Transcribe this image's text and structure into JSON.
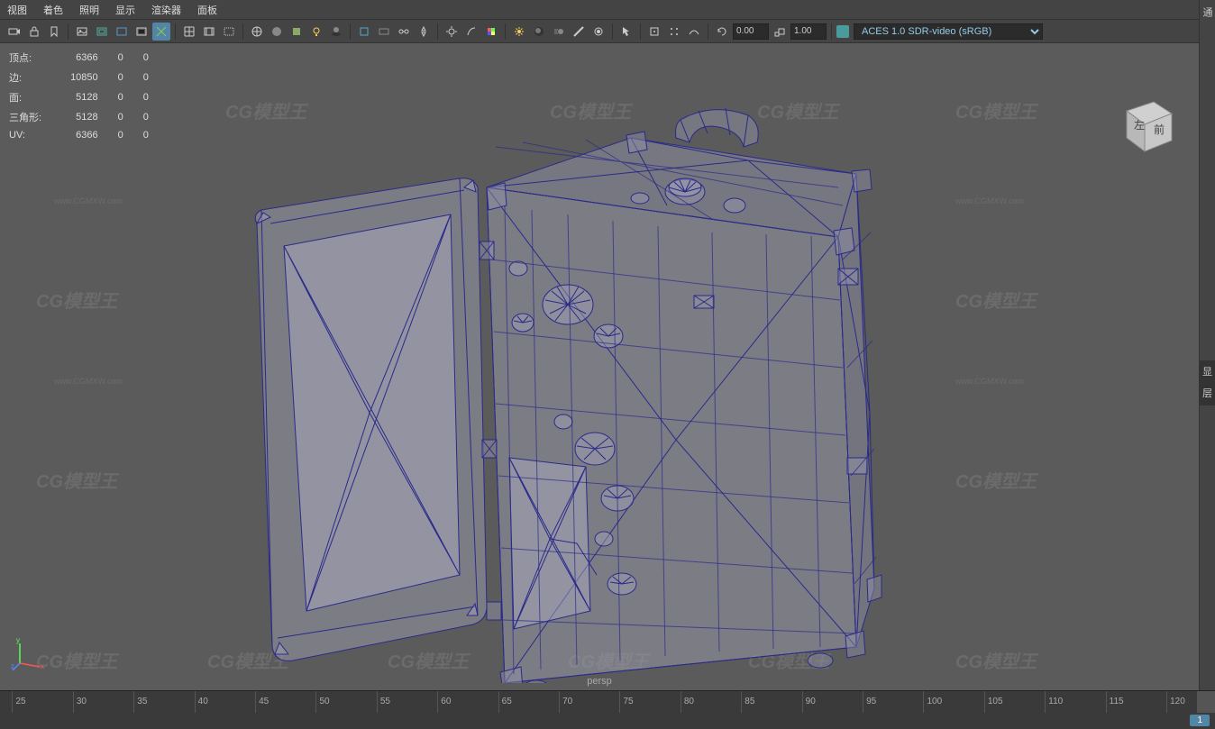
{
  "menubar": {
    "items": [
      "视图",
      "着色",
      "照明",
      "显示",
      "渲染器",
      "面板"
    ]
  },
  "toolbar": {
    "rotation_value": "0.00",
    "scale_value": "1.00",
    "colorspace": "ACES 1.0 SDR-video (sRGB)"
  },
  "stats": {
    "rows": [
      {
        "label": "顶点:",
        "v1": "6366",
        "v2": "0",
        "v3": "0"
      },
      {
        "label": "边:",
        "v1": "10850",
        "v2": "0",
        "v3": "0"
      },
      {
        "label": "面:",
        "v1": "5128",
        "v2": "0",
        "v3": "0"
      },
      {
        "label": "三角形:",
        "v1": "5128",
        "v2": "0",
        "v3": "0"
      },
      {
        "label": "UV:",
        "v1": "6366",
        "v2": "0",
        "v3": "0"
      }
    ]
  },
  "watermark": {
    "main": "CG模型王",
    "sub": "www.CGMXW.com"
  },
  "viewcube": {
    "left": "左",
    "front": "前"
  },
  "camera": {
    "name": "persp"
  },
  "right_panel": {
    "top_label": "通",
    "mid_labels": [
      "显",
      "层"
    ]
  },
  "timeline": {
    "ticks": [
      25,
      30,
      35,
      40,
      45,
      50,
      55,
      60,
      65,
      70,
      75,
      80,
      85,
      90,
      95,
      100,
      105,
      110,
      115,
      120
    ],
    "current": "1"
  },
  "axis": {
    "x": "x",
    "y": "y",
    "z": "z"
  }
}
